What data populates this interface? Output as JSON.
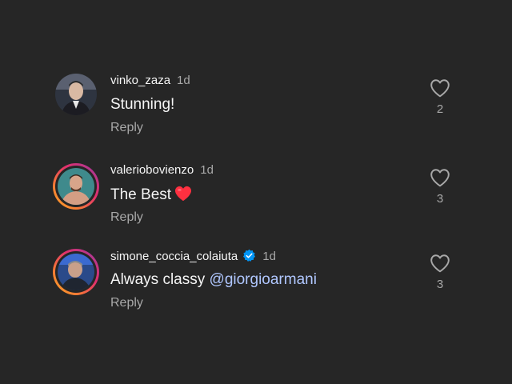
{
  "comments": [
    {
      "username": "vinko_zaza",
      "time": "1d",
      "text": "Stunning!",
      "reply_label": "Reply",
      "likes": "2",
      "has_story_ring": false,
      "verified": false
    },
    {
      "username": "valeriobovienzo",
      "time": "1d",
      "text": "The Best",
      "emoji": "red-heart",
      "reply_label": "Reply",
      "likes": "3",
      "has_story_ring": true,
      "verified": false
    },
    {
      "username": "simone_coccia_colaiuta",
      "time": "1d",
      "text": "Always classy ",
      "mention": "@giorgioarmani",
      "reply_label": "Reply",
      "likes": "3",
      "has_story_ring": true,
      "verified": true
    }
  ],
  "colors": {
    "background": "#262626",
    "secondary_text": "#a8a8a8",
    "mention": "#b0c7ff",
    "verified": "#0095f6",
    "emoji_heart": "#ff3040"
  },
  "icons": {
    "like": "heart-outline-icon",
    "verified": "verified-badge-icon"
  }
}
